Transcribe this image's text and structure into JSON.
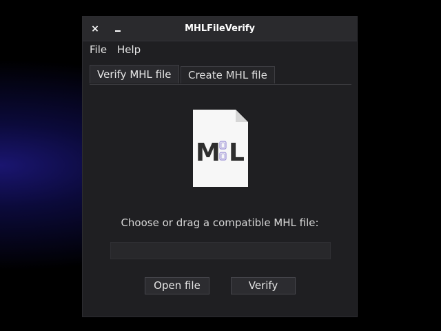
{
  "window": {
    "title": "MHLFileVerify",
    "close_glyph": "×",
    "minimize_icon": "minimize-icon"
  },
  "menu": {
    "file": "File",
    "help": "Help"
  },
  "tabs": [
    {
      "label": "Verify MHL file",
      "active": true
    },
    {
      "label": "Create MHL file",
      "active": false
    }
  ],
  "main": {
    "icon": "mhl-document-icon",
    "icon_text_left": "M",
    "icon_text_right": "L",
    "prompt": "Choose or drag a compatible MHL file:",
    "path_value": "",
    "path_placeholder": "",
    "open_label": "Open file",
    "verify_label": "Verify"
  },
  "colors": {
    "window_bg": "#1f1f22",
    "titlebar_bg": "#2a2a2d",
    "text": "#e6e6e6",
    "accent_purple": "#8a7fc8"
  }
}
